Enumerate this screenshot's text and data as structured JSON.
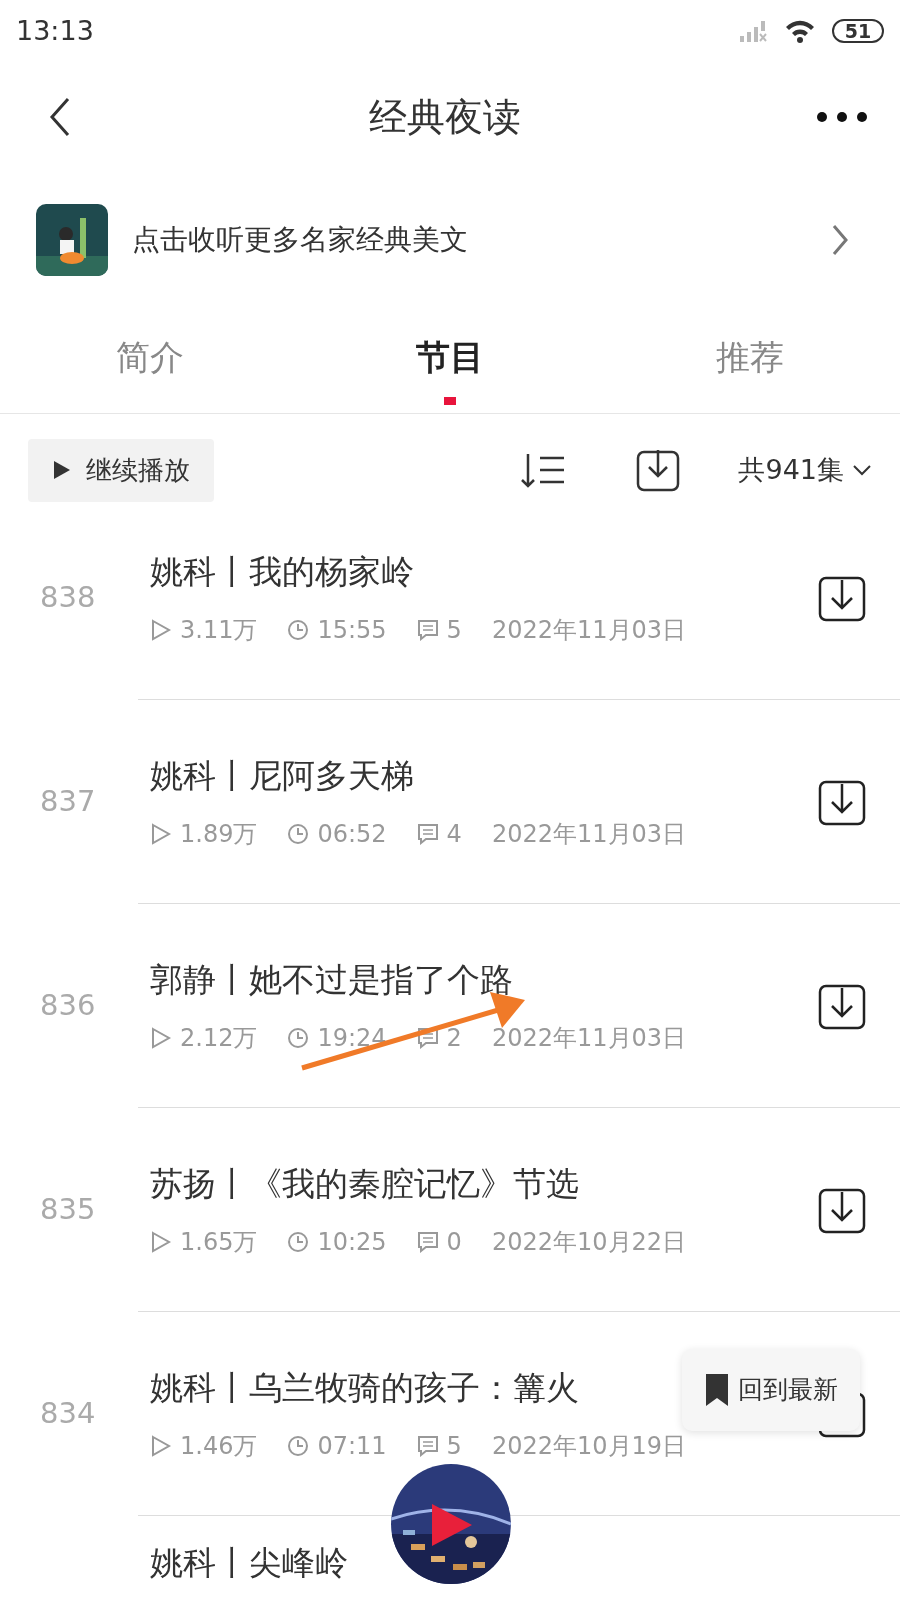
{
  "status_bar": {
    "time": "13:13",
    "battery": "51"
  },
  "header": {
    "title": "经典夜读"
  },
  "banner": {
    "text": "点击收听更多名家经典美文"
  },
  "tabs": [
    {
      "label": "简介",
      "selected": false
    },
    {
      "label": "节目",
      "selected": true
    },
    {
      "label": "推荐",
      "selected": false
    }
  ],
  "toolbar": {
    "continue_button": "继续播放",
    "episode_count": "共941集"
  },
  "episodes": [
    {
      "number": "838",
      "title": "姚科丨我的杨家岭",
      "plays": "3.11万",
      "duration": "15:55",
      "comments": "5",
      "date": "2022年11月03日"
    },
    {
      "number": "837",
      "title": "姚科丨尼阿多天梯",
      "plays": "1.89万",
      "duration": "06:52",
      "comments": "4",
      "date": "2022年11月03日"
    },
    {
      "number": "836",
      "title": "郭静丨她不过是指了个路",
      "plays": "2.12万",
      "duration": "19:24",
      "comments": "2",
      "date": "2022年11月03日"
    },
    {
      "number": "835",
      "title": "苏扬丨《我的秦腔记忆》节选",
      "plays": "1.65万",
      "duration": "10:25",
      "comments": "0",
      "date": "2022年10月22日"
    },
    {
      "number": "834",
      "title": "姚科丨乌兰牧骑的孩子：篝火",
      "plays": "1.46万",
      "duration": "07:11",
      "comments": "5",
      "date": "2022年10月19日"
    },
    {
      "title": "姚科丨尖峰岭"
    }
  ],
  "back_to_latest": "回到最新"
}
